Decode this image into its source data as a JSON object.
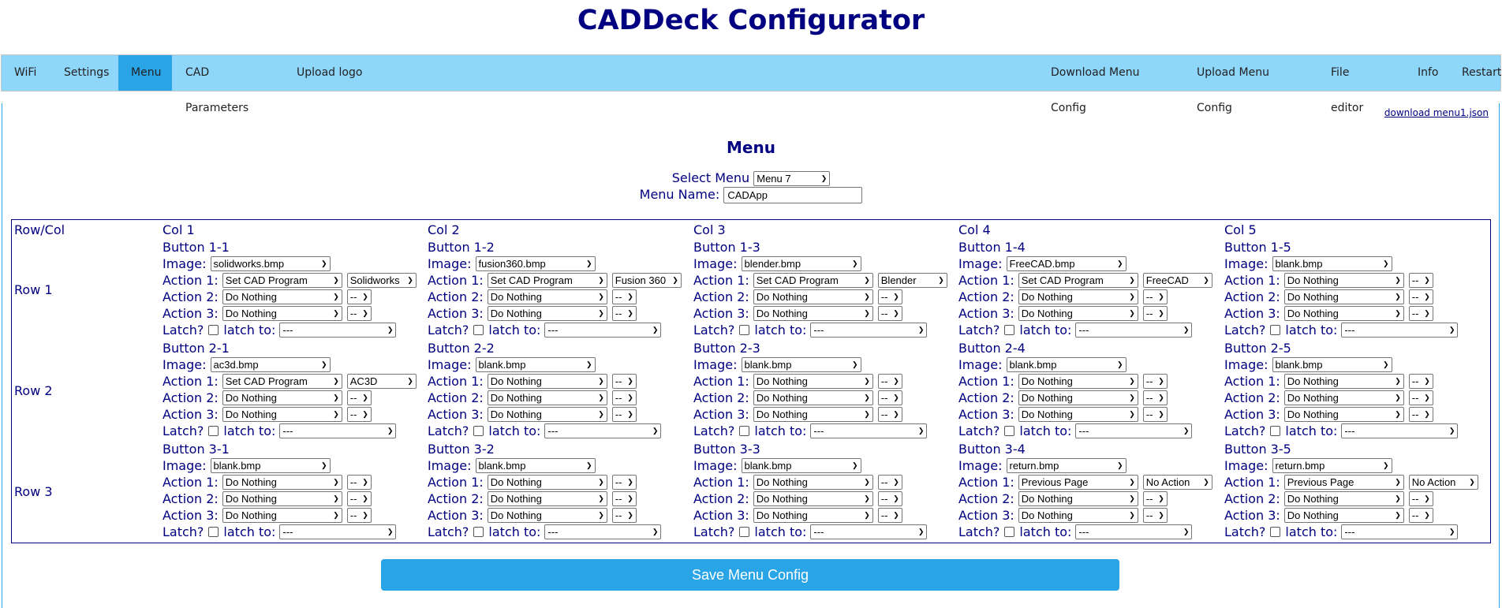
{
  "app_title": "CADDeck Configurator",
  "nav": {
    "left": [
      {
        "label": "WiFi",
        "active": false
      },
      {
        "label": "Settings",
        "active": false
      },
      {
        "label": "Menu",
        "active": true
      },
      {
        "label": "CAD Parameters",
        "active": false
      },
      {
        "label": "Upload logo",
        "active": false
      }
    ],
    "right": [
      {
        "label": "Download Menu Config"
      },
      {
        "label": "Upload Menu Config"
      },
      {
        "label": "File editor"
      },
      {
        "label": "Info"
      },
      {
        "label": "Restart"
      }
    ]
  },
  "download_link": "download menu1.json",
  "heading": "Menu",
  "select_menu": {
    "label": "Select Menu",
    "value": "Menu 7"
  },
  "menu_name": {
    "label": "Menu Name:",
    "value": "CADApp"
  },
  "grid": {
    "corner_label": "Row/Col",
    "col_headers": [
      "Col 1",
      "Col 2",
      "Col 3",
      "Col 4",
      "Col 5"
    ],
    "row_labels": [
      "Row 1",
      "Row 2",
      "Row 3"
    ],
    "field_labels": {
      "image": "Image:",
      "action1": "Action 1:",
      "action2": "Action 2:",
      "action3": "Action 3:",
      "latch": "Latch?",
      "latch_to": "latch to:"
    },
    "rows": [
      [
        {
          "title": "Button 1-1",
          "image": "solidworks.bmp",
          "a1": "Set CAD Program",
          "a1v": "Solidworks",
          "a2": "Do Nothing",
          "a2v": "--",
          "a3": "Do Nothing",
          "a3v": "--",
          "latch": false,
          "latch_to": "---"
        },
        {
          "title": "Button 1-2",
          "image": "fusion360.bmp",
          "a1": "Set CAD Program",
          "a1v": "Fusion 360",
          "a2": "Do Nothing",
          "a2v": "--",
          "a3": "Do Nothing",
          "a3v": "--",
          "latch": false,
          "latch_to": "---"
        },
        {
          "title": "Button 1-3",
          "image": "blender.bmp",
          "a1": "Set CAD Program",
          "a1v": "Blender",
          "a2": "Do Nothing",
          "a2v": "--",
          "a3": "Do Nothing",
          "a3v": "--",
          "latch": false,
          "latch_to": "---"
        },
        {
          "title": "Button 1-4",
          "image": "FreeCAD.bmp",
          "a1": "Set CAD Program",
          "a1v": "FreeCAD",
          "a2": "Do Nothing",
          "a2v": "--",
          "a3": "Do Nothing",
          "a3v": "--",
          "latch": false,
          "latch_to": "---"
        },
        {
          "title": "Button 1-5",
          "image": "blank.bmp",
          "a1": "Do Nothing",
          "a1v": "--",
          "a2": "Do Nothing",
          "a2v": "--",
          "a3": "Do Nothing",
          "a3v": "--",
          "latch": false,
          "latch_to": "---"
        }
      ],
      [
        {
          "title": "Button 2-1",
          "image": "ac3d.bmp",
          "a1": "Set CAD Program",
          "a1v": "AC3D",
          "a2": "Do Nothing",
          "a2v": "--",
          "a3": "Do Nothing",
          "a3v": "--",
          "latch": false,
          "latch_to": "---"
        },
        {
          "title": "Button 2-2",
          "image": "blank.bmp",
          "a1": "Do Nothing",
          "a1v": "--",
          "a2": "Do Nothing",
          "a2v": "--",
          "a3": "Do Nothing",
          "a3v": "--",
          "latch": false,
          "latch_to": "---"
        },
        {
          "title": "Button 2-3",
          "image": "blank.bmp",
          "a1": "Do Nothing",
          "a1v": "--",
          "a2": "Do Nothing",
          "a2v": "--",
          "a3": "Do Nothing",
          "a3v": "--",
          "latch": false,
          "latch_to": "---"
        },
        {
          "title": "Button 2-4",
          "image": "blank.bmp",
          "a1": "Do Nothing",
          "a1v": "--",
          "a2": "Do Nothing",
          "a2v": "--",
          "a3": "Do Nothing",
          "a3v": "--",
          "latch": false,
          "latch_to": "---"
        },
        {
          "title": "Button 2-5",
          "image": "blank.bmp",
          "a1": "Do Nothing",
          "a1v": "--",
          "a2": "Do Nothing",
          "a2v": "--",
          "a3": "Do Nothing",
          "a3v": "--",
          "latch": false,
          "latch_to": "---"
        }
      ],
      [
        {
          "title": "Button 3-1",
          "image": "blank.bmp",
          "a1": "Do Nothing",
          "a1v": "--",
          "a2": "Do Nothing",
          "a2v": "--",
          "a3": "Do Nothing",
          "a3v": "--",
          "latch": false,
          "latch_to": "---"
        },
        {
          "title": "Button 3-2",
          "image": "blank.bmp",
          "a1": "Do Nothing",
          "a1v": "--",
          "a2": "Do Nothing",
          "a2v": "--",
          "a3": "Do Nothing",
          "a3v": "--",
          "latch": false,
          "latch_to": "---"
        },
        {
          "title": "Button 3-3",
          "image": "blank.bmp",
          "a1": "Do Nothing",
          "a1v": "--",
          "a2": "Do Nothing",
          "a2v": "--",
          "a3": "Do Nothing",
          "a3v": "--",
          "latch": false,
          "latch_to": "---"
        },
        {
          "title": "Button 3-4",
          "image": "return.bmp",
          "a1": "Previous Page",
          "a1v": "No Action",
          "a2": "Do Nothing",
          "a2v": "--",
          "a3": "Do Nothing",
          "a3v": "--",
          "latch": false,
          "latch_to": "---"
        },
        {
          "title": "Button 3-5",
          "image": "return.bmp",
          "a1": "Previous Page",
          "a1v": "No Action",
          "a2": "Do Nothing",
          "a2v": "--",
          "a3": "Do Nothing",
          "a3v": "--",
          "latch": false,
          "latch_to": "---"
        }
      ]
    ]
  },
  "save_button": "Save Menu Config",
  "colors": {
    "navy": "#000080",
    "nav_bg": "#8fd6fb",
    "accent": "#29a4e6"
  }
}
